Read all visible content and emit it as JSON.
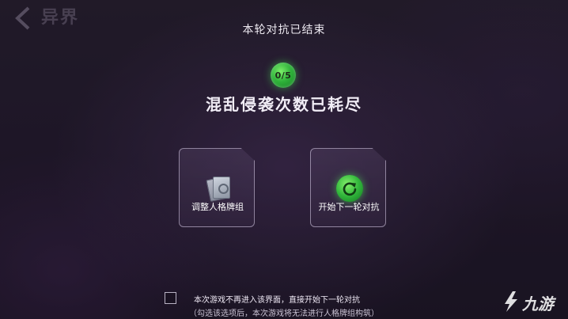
{
  "header": {
    "back_title": "异界",
    "round_title": "本轮对抗已结束"
  },
  "counter": {
    "value": "0/5",
    "used": 0,
    "total": 5
  },
  "status_text": "混乱侵袭次数已耗尽",
  "actions": {
    "adjust_deck_label": "调整人格牌组",
    "next_round_label": "开始下一轮对抗"
  },
  "skip_option": {
    "label": "本次游戏不再进入该界面，直接开始下一轮对抗",
    "checked": false,
    "note": "（勾选该选项后，本次游戏将无法进行人格牌组构筑）"
  },
  "watermark": {
    "text": "九游"
  },
  "colors": {
    "accent_green": "#31b63b",
    "text_primary": "#f1edf6"
  }
}
